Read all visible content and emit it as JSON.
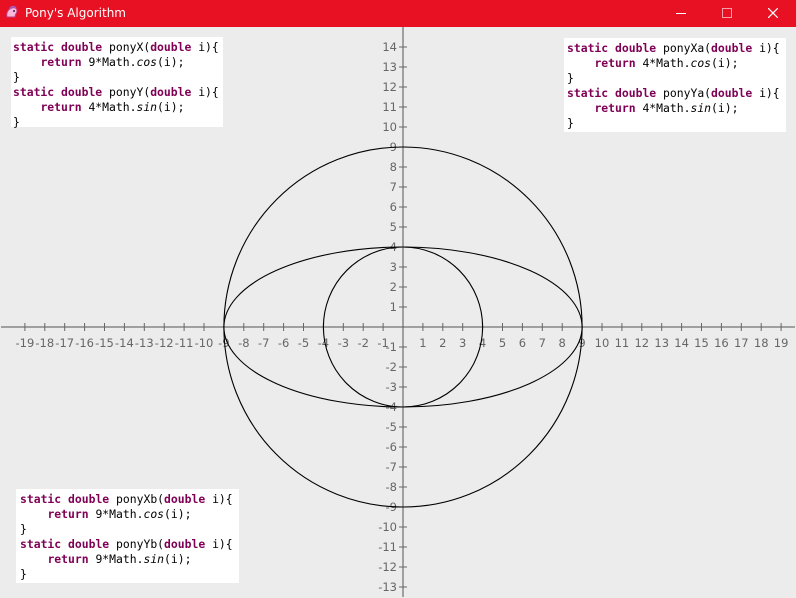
{
  "window": {
    "title": "Pony's Algorithm",
    "accent_color": "#e81123",
    "icon": "pony-icon",
    "controls": [
      "minimize-icon",
      "maximize-icon",
      "close-icon"
    ]
  },
  "code_blocks": {
    "top_left": {
      "l1": {
        "a": "static",
        "b": "double",
        "c": "ponyX(",
        "d": "double",
        "e": "i){"
      },
      "l2": {
        "a": "return",
        "b": "9*Math.",
        "c": "cos",
        "d": "(i);"
      },
      "l3": "}",
      "l4": {
        "a": "static",
        "b": "double",
        "c": "ponyY(",
        "d": "double",
        "e": "i){"
      },
      "l5": {
        "a": "return",
        "b": "4*Math.",
        "c": "sin",
        "d": "(i);"
      },
      "l6": "}"
    },
    "top_right": {
      "l1": {
        "a": "static",
        "b": "double",
        "c": "ponyXa(",
        "d": "double",
        "e": "i){"
      },
      "l2": {
        "a": "return",
        "b": "4*Math.",
        "c": "cos",
        "d": "(i);"
      },
      "l3": "}",
      "l4": {
        "a": "static",
        "b": "double",
        "c": "ponyYa(",
        "d": "double",
        "e": "i){"
      },
      "l5": {
        "a": "return",
        "b": "4*Math.",
        "c": "sin",
        "d": "(i);"
      },
      "l6": "}"
    },
    "bottom_left": {
      "l1": {
        "a": "static",
        "b": "double",
        "c": "ponyXb(",
        "d": "double",
        "e": "i){"
      },
      "l2": {
        "a": "return",
        "b": "9*Math.",
        "c": "cos",
        "d": "(i);"
      },
      "l3": "}",
      "l4": {
        "a": "static",
        "b": "double",
        "c": "ponyYb(",
        "d": "double",
        "e": "i){"
      },
      "l5": {
        "a": "return",
        "b": "9*Math.",
        "c": "sin",
        "d": "(i);"
      },
      "l6": "}"
    }
  },
  "chart_data": {
    "type": "line",
    "xlim": [
      -19,
      19
    ],
    "ylim": [
      -13,
      14
    ],
    "x_ticks": [
      -19,
      -18,
      -17,
      -16,
      -15,
      -14,
      -13,
      -12,
      -11,
      -10,
      -9,
      -8,
      -7,
      -6,
      -5,
      -4,
      -3,
      -2,
      -1,
      1,
      2,
      3,
      4,
      5,
      6,
      7,
      8,
      9,
      10,
      11,
      12,
      13,
      14,
      15,
      16,
      17,
      18,
      19
    ],
    "y_ticks": [
      14,
      13,
      12,
      11,
      10,
      9,
      8,
      7,
      6,
      5,
      4,
      3,
      2,
      1,
      -1,
      -2,
      -3,
      -4,
      -5,
      -6,
      -7,
      -8,
      -9,
      -10,
      -11,
      -12,
      -13
    ],
    "grid": false,
    "curves": [
      {
        "x": "9*cos(t)",
        "y": "4*sin(t)",
        "rx": 9,
        "ry": 4
      },
      {
        "x": "4*cos(t)",
        "y": "4*sin(t)",
        "rx": 4,
        "ry": 4
      },
      {
        "x": "9*cos(t)",
        "y": "9*sin(t)",
        "rx": 9,
        "ry": 9
      }
    ]
  }
}
